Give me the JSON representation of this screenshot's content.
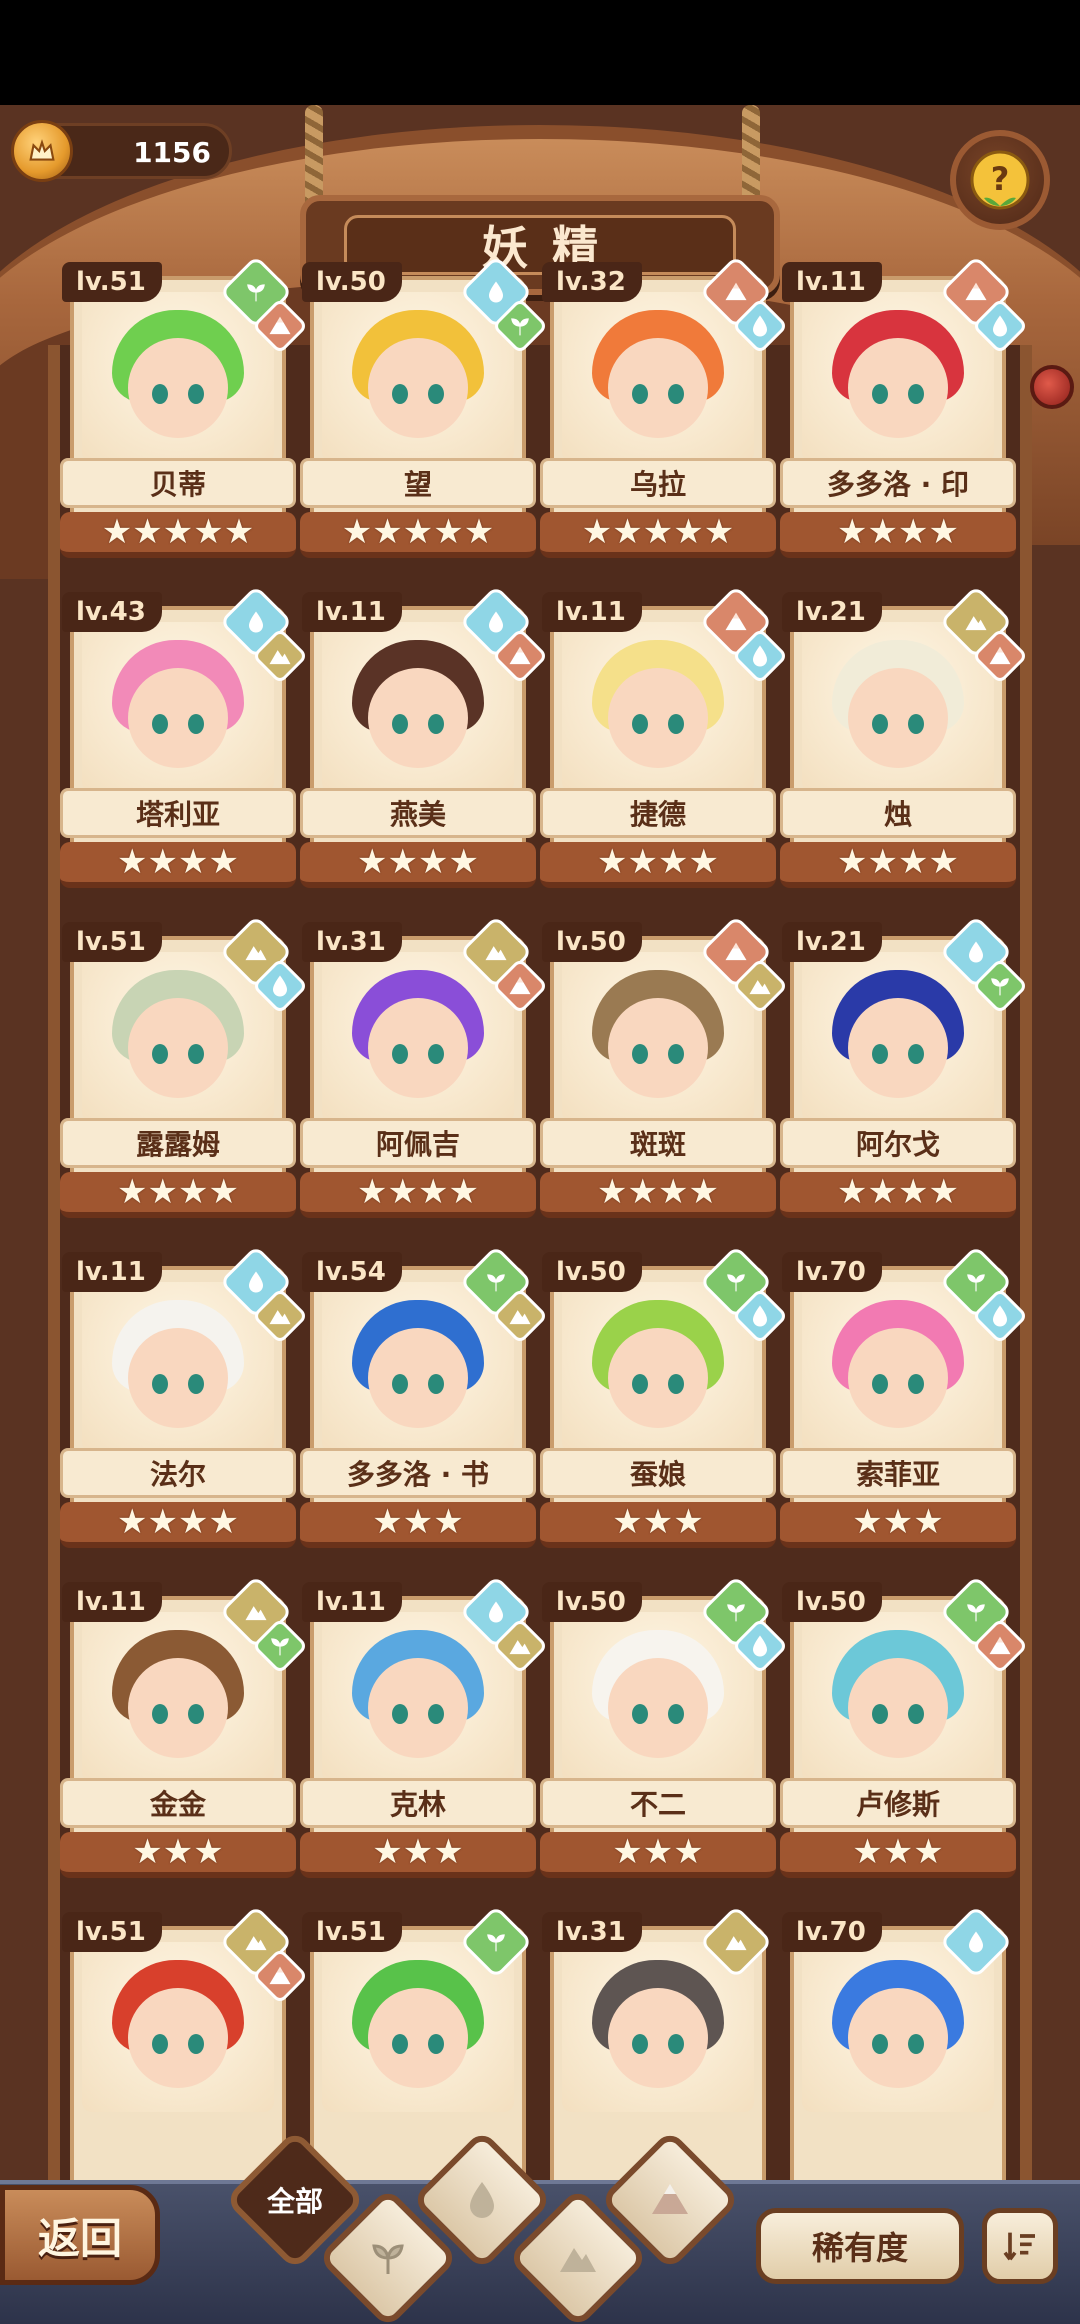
{
  "header": {
    "coins": "1156",
    "title": "妖精"
  },
  "colors": {
    "leaf": "#7ec66a",
    "water": "#8fd6e6",
    "fire": "#d9876a",
    "earth": "#c9b36a"
  },
  "fairies": [
    {
      "level": "lv.51",
      "name": "贝蒂",
      "stars": "★★★★★",
      "hair": "#6fcf4f",
      "element": "leaf",
      "sub": "fire"
    },
    {
      "level": "lv.50",
      "name": "望",
      "stars": "★★★★★",
      "hair": "#f2c13a",
      "element": "water",
      "sub": "leaf"
    },
    {
      "level": "lv.32",
      "name": "乌拉",
      "stars": "★★★★★",
      "hair": "#f07a3a",
      "element": "fire",
      "sub": "water"
    },
    {
      "level": "lv.11",
      "name": "多多洛 · 印",
      "stars": "★★★★",
      "hair": "#d8343e",
      "element": "fire",
      "sub": "water"
    },
    {
      "level": "lv.43",
      "name": "塔利亚",
      "stars": "★★★★",
      "hair": "#f28ab8",
      "element": "water",
      "sub": "earth"
    },
    {
      "level": "lv.11",
      "name": "燕美",
      "stars": "★★★★",
      "hair": "#5a3326",
      "element": "water",
      "sub": "fire"
    },
    {
      "level": "lv.11",
      "name": "捷德",
      "stars": "★★★★",
      "hair": "#f5e08a",
      "element": "fire",
      "sub": "water"
    },
    {
      "level": "lv.21",
      "name": "烛",
      "stars": "★★★★",
      "hair": "#f1ecd8",
      "element": "earth",
      "sub": "fire"
    },
    {
      "level": "lv.51",
      "name": "露露姆",
      "stars": "★★★★",
      "hair": "#c8d4b4",
      "element": "earth",
      "sub": "water"
    },
    {
      "level": "lv.31",
      "name": "阿佩吉",
      "stars": "★★★★",
      "hair": "#8a4ed8",
      "element": "earth",
      "sub": "fire"
    },
    {
      "level": "lv.50",
      "name": "斑斑",
      "stars": "★★★★",
      "hair": "#9a7a52",
      "element": "fire",
      "sub": "earth"
    },
    {
      "level": "lv.21",
      "name": "阿尔戈",
      "stars": "★★★★",
      "hair": "#2a3aa8",
      "element": "water",
      "sub": "leaf"
    },
    {
      "level": "lv.11",
      "name": "法尔",
      "stars": "★★★★",
      "hair": "#f5f3ee",
      "element": "water",
      "sub": "earth"
    },
    {
      "level": "lv.54",
      "name": "多多洛 · 书",
      "stars": "★★★",
      "hair": "#2f6fd0",
      "element": "leaf",
      "sub": "earth"
    },
    {
      "level": "lv.50",
      "name": "蚕娘",
      "stars": "★★★",
      "hair": "#9ad24a",
      "element": "leaf",
      "sub": "water"
    },
    {
      "level": "lv.70",
      "name": "索菲亚",
      "stars": "★★★",
      "hair": "#f27ab2",
      "element": "leaf",
      "sub": "water"
    },
    {
      "level": "lv.11",
      "name": "金金",
      "stars": "★★★",
      "hair": "#8b5a34",
      "element": "earth",
      "sub": "leaf"
    },
    {
      "level": "lv.11",
      "name": "克林",
      "stars": "★★★",
      "hair": "#5aa8e0",
      "element": "water",
      "sub": "earth"
    },
    {
      "level": "lv.50",
      "name": "不二",
      "stars": "★★★",
      "hair": "#f7f4ee",
      "element": "leaf",
      "sub": "water"
    },
    {
      "level": "lv.50",
      "name": "卢修斯",
      "stars": "★★★",
      "hair": "#6cc8d8",
      "element": "leaf",
      "sub": "fire"
    },
    {
      "level": "lv.51",
      "name": "",
      "stars": "",
      "hair": "#d8402c",
      "element": "earth",
      "sub": "fire"
    },
    {
      "level": "lv.51",
      "name": "",
      "stars": "",
      "hair": "#58c24a",
      "element": "leaf",
      "sub": ""
    },
    {
      "level": "lv.31",
      "name": "",
      "stars": "",
      "hair": "#5e5552",
      "element": "earth",
      "sub": ""
    },
    {
      "level": "lv.70",
      "name": "",
      "stars": "",
      "hair": "#3a7ae0",
      "element": "water",
      "sub": ""
    }
  ],
  "bottom": {
    "back_label": "返回",
    "filter_all_label": "全部",
    "rarity_label": "稀有度"
  }
}
